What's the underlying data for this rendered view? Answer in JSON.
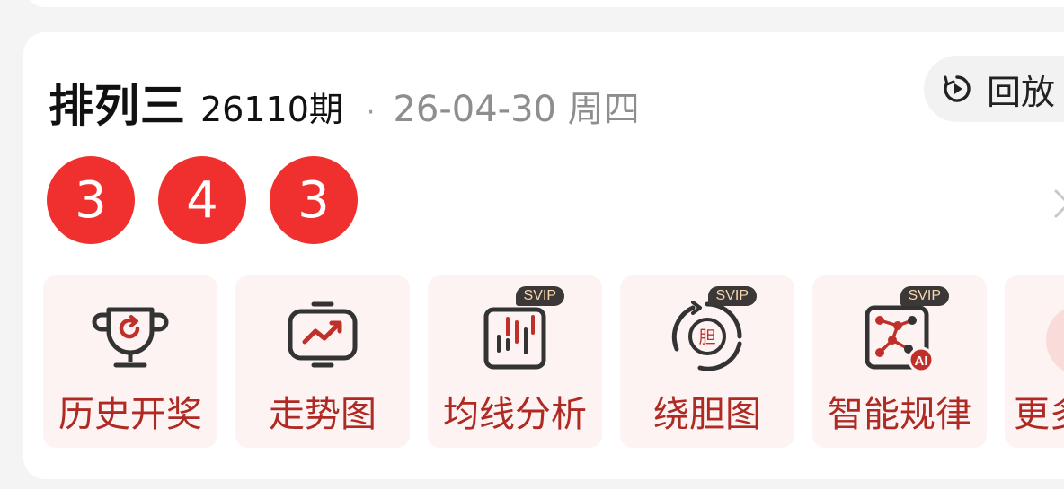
{
  "header": {
    "lottery_name": "排列三",
    "issue": "26110期",
    "separator": "·",
    "draw_date": "26-04-30 周四"
  },
  "replay": {
    "label": "回放",
    "icon": "replay-icon"
  },
  "numbers": [
    "3",
    "4",
    "3"
  ],
  "tools": [
    {
      "label": "历史开奖",
      "icon": "trophy-icon",
      "badge": ""
    },
    {
      "label": "走势图",
      "icon": "trend-chart-icon",
      "badge": ""
    },
    {
      "label": "均线分析",
      "icon": "candlestick-icon",
      "badge": "SVIP"
    },
    {
      "label": "绕胆图",
      "icon": "cycle-dan-icon",
      "badge": "SVIP",
      "icon_text": "胆"
    },
    {
      "label": "智能规律",
      "icon": "ai-dice-icon",
      "badge": "SVIP",
      "icon_text": "AI"
    },
    {
      "label": "更多",
      "icon": "more-icon",
      "badge": ""
    }
  ],
  "colors": {
    "ball": "#f0302f",
    "tool_bg": "#fdf3f2",
    "tool_label": "#b02a24",
    "icon_dark": "#333333",
    "icon_red": "#c0302b",
    "svip_bg": "#3c3838",
    "svip_text": "#f7d7b0"
  }
}
